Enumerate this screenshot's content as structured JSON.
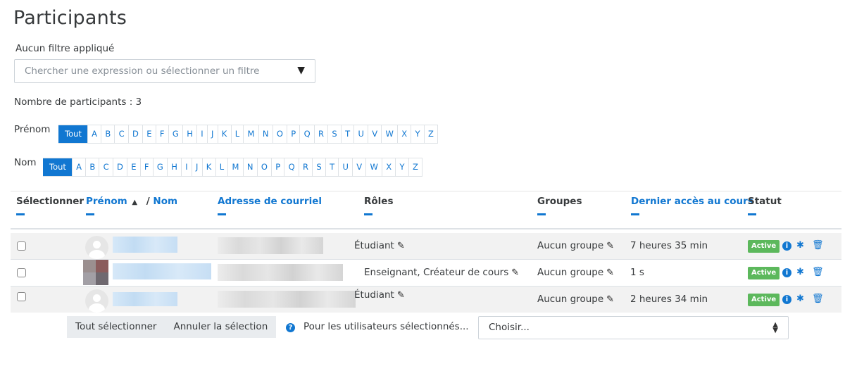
{
  "page": {
    "title": "Participants"
  },
  "filter": {
    "label": "Aucun filtre appliqué",
    "placeholder": "Chercher une expression ou sélectionner un filtre"
  },
  "count_text": "Nombre de participants : 3",
  "initials": {
    "firstname_label": "Prénom",
    "lastname_label": "Nom",
    "all_label": "Tout",
    "letters": [
      "A",
      "B",
      "C",
      "D",
      "E",
      "F",
      "G",
      "H",
      "I",
      "J",
      "K",
      "L",
      "M",
      "N",
      "O",
      "P",
      "Q",
      "R",
      "S",
      "T",
      "U",
      "V",
      "W",
      "X",
      "Y",
      "Z"
    ]
  },
  "table": {
    "headers": {
      "select": "Sélectionner",
      "firstname": "Prénom",
      "sort_indicator": "▲",
      "separator": "/",
      "lastname": "Nom",
      "email": "Adresse de courriel",
      "roles": "Rôles",
      "groups": "Groupes",
      "last_access": "Dernier accès au cours",
      "status": "Statut"
    },
    "rows": [
      {
        "role": "Étudiant",
        "group": "Aucun groupe",
        "last_access": "7 heures 35 min",
        "status": "Active"
      },
      {
        "role": "Enseignant, Créateur de cours",
        "group": "Aucun groupe",
        "last_access": "1 s",
        "status": "Active"
      },
      {
        "role": "Étudiant",
        "group": "Aucun groupe",
        "last_access": "2 heures 34 min",
        "status": "Active"
      }
    ]
  },
  "footer": {
    "select_all": "Tout sélectionner",
    "deselect": "Annuler la sélection",
    "for_selected": "Pour les utilisateurs sélectionnés...",
    "choose": "Choisir..."
  },
  "icons": {
    "edit": "pencil-icon",
    "info": "info-icon",
    "settings": "gear-icon",
    "delete": "trash-icon",
    "help": "help-icon"
  },
  "colors": {
    "link": "#1177d1",
    "active_badge": "#5cb85c",
    "row_stripe": "#f2f2f2"
  }
}
